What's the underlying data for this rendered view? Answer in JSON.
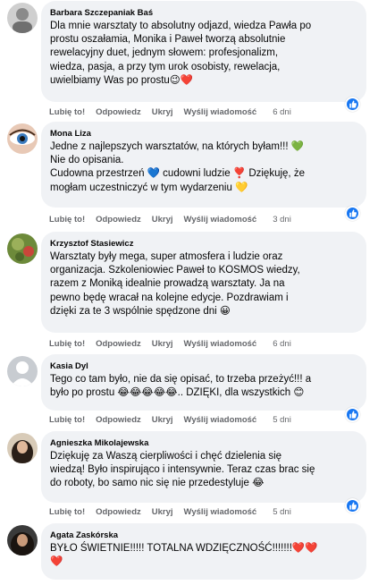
{
  "comments": [
    {
      "author": "Barbara Szczepaniak Baś",
      "text": "Dla mnie warsztaty to absolutny odjazd, wiedza Pawła po\nprostu oszałamia, Monika i Paweł tworzą absolutnie\nrewelacyjny duet, jednym słowem: profesjonalizm,\nwiedza, pasja, a przy tym urok osobisty, rewelacja,\nuwielbiamy Was po prostu😉❤️",
      "like": "Lubię to!",
      "reply": "Odpowiedz",
      "hide": "Ukryj",
      "message": "Wyślij wiadomość",
      "time": "6 dni"
    },
    {
      "author": "Mona Liza",
      "text": "Jedne z najlepszych warsztatów, na których byłam!!! 💚\nNie do opisania.\nCudowna przestrzeń 💙 cudowni ludzie ❣️ Dziękuję, że\nmogłam uczestniczyć w tym wydarzeniu 💛",
      "like": "Lubię to!",
      "reply": "Odpowiedz",
      "hide": "Ukryj",
      "message": "Wyślij wiadomość",
      "time": "3 dni"
    },
    {
      "author": "Krzysztof Stasiewicz",
      "text": "Warsztaty były mega, super atmosfera i ludzie oraz\norganizacja. Szkoleniowiec Paweł to KOSMOS wiedzy,\nrazem z Moniką idealnie prowadzą warsztaty. Ja na\npewno będę wracał na kolejne edycje. Pozdrawiam i\ndzięki za te 3 wspólnie spędzone dni 😀",
      "like": "Lubię to!",
      "reply": "Odpowiedz",
      "hide": "Ukryj",
      "message": "Wyślij wiadomość",
      "time": "6 dni"
    },
    {
      "author": "Kasia Dyl",
      "text": "Tego co tam było, nie da się opisać, to trzeba przeżyć!!! a\nbyło po prostu 😂😂😂😂😂.. DZIĘKI, dla wszystkich 😊",
      "like": "Lubię to!",
      "reply": "Odpowiedz",
      "hide": "Ukryj",
      "message": "Wyślij wiadomość",
      "time": "5 dni"
    },
    {
      "author": "Agnieszka Mikolajewska",
      "text": "Dziękuję za Waszą cierpliwości i chęć dzielenia się\nwiedzą! Było inspirująco i intensywnie. Teraz czas brac się\ndo roboty, bo samo nic się nie przedestyluje 😂",
      "like": "Lubię to!",
      "reply": "Odpowiedz",
      "hide": "Ukryj",
      "message": "Wyślij wiadomość",
      "time": "5 dni"
    },
    {
      "author": "Agata Zaskórska",
      "text": "BYŁO ŚWIETNIE!!!!! TOTALNA WDZIĘCZNOŚĆ!!!!!!!❤️❤️\n❤️"
    }
  ],
  "colors": {
    "bubble": "#f0f2f5",
    "meta": "#65676b",
    "like_badge": "#1877f2"
  },
  "icons": {
    "like_badge": "thumbs-up-icon"
  }
}
